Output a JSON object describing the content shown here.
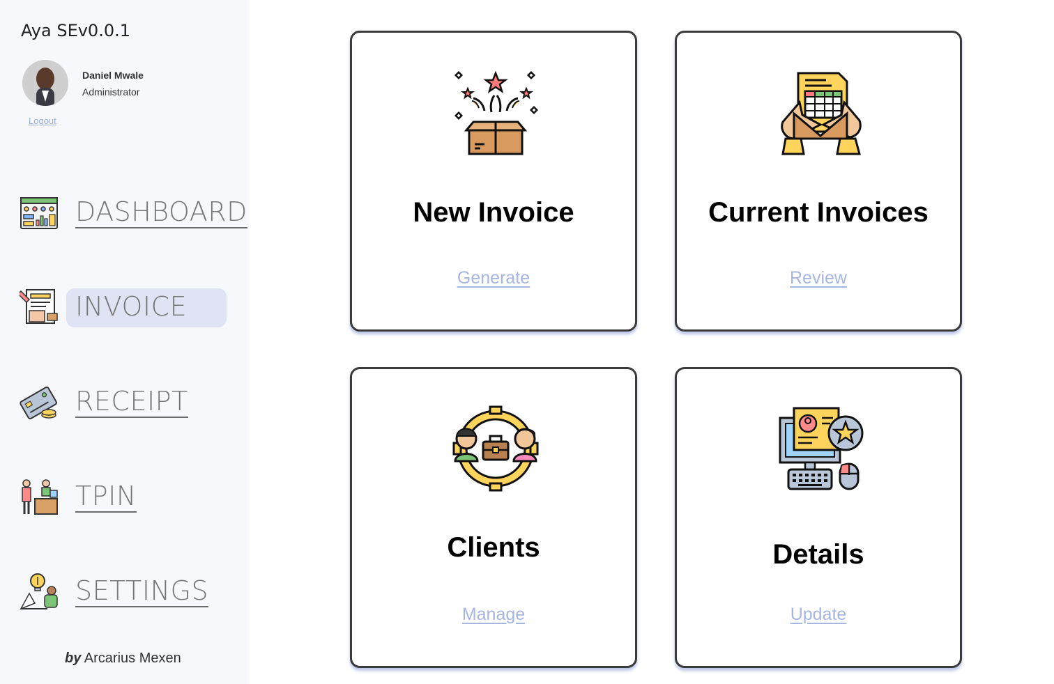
{
  "app": {
    "title": "Aya SEv0.0.1"
  },
  "user": {
    "name": "Daniel Mwale",
    "role": "Administrator",
    "logout_label": "Logout"
  },
  "nav": {
    "items": [
      {
        "label": "DASHBOARD",
        "icon": "dashboard-icon",
        "active": false
      },
      {
        "label": "INVOICE",
        "icon": "invoice-icon",
        "active": true
      },
      {
        "label": "RECEIPT",
        "icon": "receipt-icon",
        "active": false
      },
      {
        "label": "TPIN",
        "icon": "tpin-icon",
        "active": false
      },
      {
        "label": "SETTINGS",
        "icon": "settings-icon",
        "active": false
      }
    ]
  },
  "credit": {
    "by": "by",
    "author": "Arcarius Mexen"
  },
  "cards": [
    {
      "title": "New Invoice",
      "link": "Generate",
      "icon": "gift-box-icon"
    },
    {
      "title": "Current Invoices",
      "link": "Review",
      "icon": "document-hands-icon"
    },
    {
      "title": "Clients",
      "link": "Manage",
      "icon": "clients-gear-icon"
    },
    {
      "title": "Details",
      "link": "Update",
      "icon": "computer-profile-icon"
    }
  ],
  "colors": {
    "sidebar_bg": "#f7f8fc",
    "active_pill": "#dfe3f3",
    "link": "#a6b6e0",
    "card_border": "#3a3a3a"
  }
}
